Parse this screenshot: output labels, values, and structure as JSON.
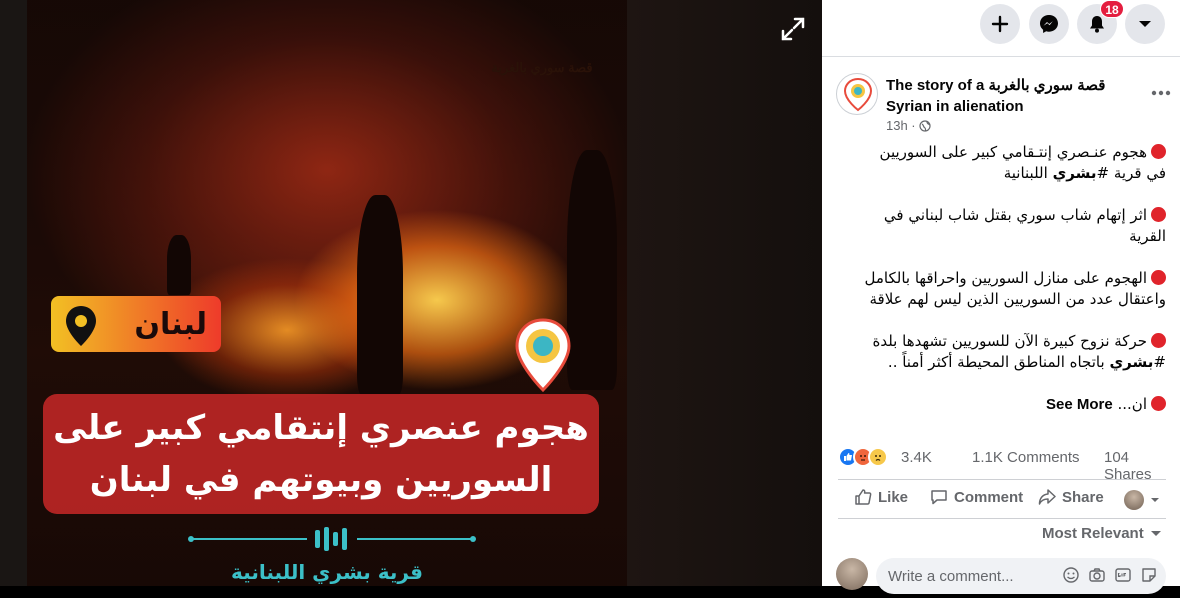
{
  "photo": {
    "banner_line_1": "هجوم عنصري إنتقامي كبير على",
    "banner_line_2": "السوريين وبيوتهم في لبنان",
    "location_tag": "لبنان",
    "watermark": "قصة سوري بالغربة",
    "bottom_caption": "قرية بشري اللبنانية"
  },
  "topbar": {
    "notification_count": "18"
  },
  "post": {
    "page_name": "The story of a قصة سوري بالغربة Syrian in alienation",
    "time": "13h ·",
    "paragraphs": [
      {
        "line1": "هجوم عنـصري إنتـقامي كبير على السوريين",
        "line2_pre": "في قرية #",
        "line2_bold": "بشري",
        "line2_post": " اللبنانية"
      },
      {
        "line1": "اثر إتهام شاب سوري بقتل شاب لبناني في",
        "line2_pre": "القرية",
        "line2_bold": "",
        "line2_post": ""
      },
      {
        "line1": "الهجوم على منازل السوريين واحراقها بالكامل",
        "line2_pre": "واعتقال عدد من السوريين الذين ليس لهم علاقة",
        "line2_bold": "",
        "line2_post": ""
      },
      {
        "line1": "حركة نزوح كبيرة الآن للسوريين تشهدها بلدة",
        "line2_pre": "#",
        "line2_bold": "بشري",
        "line2_post": " باتجاه المناطق المحيطة أكثر أمناً .."
      }
    ],
    "truncated_text": "ان...",
    "see_more": "See More",
    "reactions_count": "3.4K",
    "comments_count": "1.1K Comments",
    "shares_count": "104 Shares"
  },
  "actions": {
    "like": "Like",
    "comment": "Comment",
    "share": "Share"
  },
  "comments": {
    "sort_label": "Most Relevant",
    "placeholder": "Write a comment..."
  },
  "colors": {
    "accent": "#1877f2",
    "notification": "#e41e3f",
    "banner": "#c82828"
  }
}
